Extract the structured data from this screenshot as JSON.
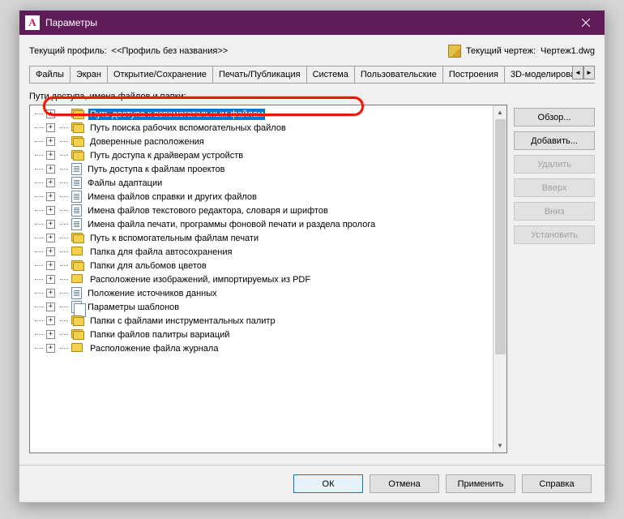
{
  "window": {
    "title": "Параметры",
    "app_letter": "A"
  },
  "profile": {
    "current_profile_label": "Текущий профиль:",
    "current_profile_value": "<<Профиль без названия>>",
    "current_drawing_label": "Текущий чертеж:",
    "current_drawing_value": "Чертеж1.dwg"
  },
  "tabs": {
    "items": [
      {
        "label": "Файлы",
        "active": true
      },
      {
        "label": "Экран"
      },
      {
        "label": "Открытие/Сохранение"
      },
      {
        "label": "Печать/Публикация"
      },
      {
        "label": "Система"
      },
      {
        "label": "Пользовательские"
      },
      {
        "label": "Построения"
      },
      {
        "label": "3D-моделирова"
      }
    ]
  },
  "tree": {
    "section_label": "Пути доступа, имена файлов и папки:",
    "items": [
      {
        "icon": "folder-multi",
        "label": "Путь доступа к вспомогательным файлам",
        "selected": true
      },
      {
        "icon": "folder-multi",
        "label": "Путь поиска рабочих вспомогательных файлов"
      },
      {
        "icon": "folder-multi",
        "label": "Доверенные расположения"
      },
      {
        "icon": "folder-multi",
        "label": "Путь доступа к драйверам устройств"
      },
      {
        "icon": "doc",
        "label": "Путь доступа к файлам проектов"
      },
      {
        "icon": "doc",
        "label": "Файлы адаптации"
      },
      {
        "icon": "doc",
        "label": "Имена файлов справки и других файлов"
      },
      {
        "icon": "doc",
        "label": "Имена файлов текстового редактора, словаря и шрифтов"
      },
      {
        "icon": "doc",
        "label": "Имена файла печати, программы фоновой печати и раздела пролога"
      },
      {
        "icon": "folder-multi",
        "label": "Путь к вспомогательным файлам печати"
      },
      {
        "icon": "folder",
        "label": "Папка для файла автосохранения"
      },
      {
        "icon": "folder-multi",
        "label": "Папки для альбомов цветов"
      },
      {
        "icon": "folder",
        "label": "Расположение изображений, импортируемых из PDF"
      },
      {
        "icon": "doc",
        "label": "Положение источников данных"
      },
      {
        "icon": "doc-multi",
        "label": "Параметры шаблонов"
      },
      {
        "icon": "folder-multi",
        "label": "Папки с файлами инструментальных палитр"
      },
      {
        "icon": "folder-multi",
        "label": "Папки файлов палитры вариаций"
      },
      {
        "icon": "folder",
        "label": "Расположение файла журнала"
      }
    ]
  },
  "side_buttons": {
    "browse": "Обзор...",
    "add": "Добавить...",
    "delete": "Удалить",
    "up": "Вверх",
    "down": "Вниз",
    "set": "Установить"
  },
  "bottom_buttons": {
    "ok": "ОК",
    "cancel": "Отмена",
    "apply": "Применить",
    "help": "Справка"
  }
}
